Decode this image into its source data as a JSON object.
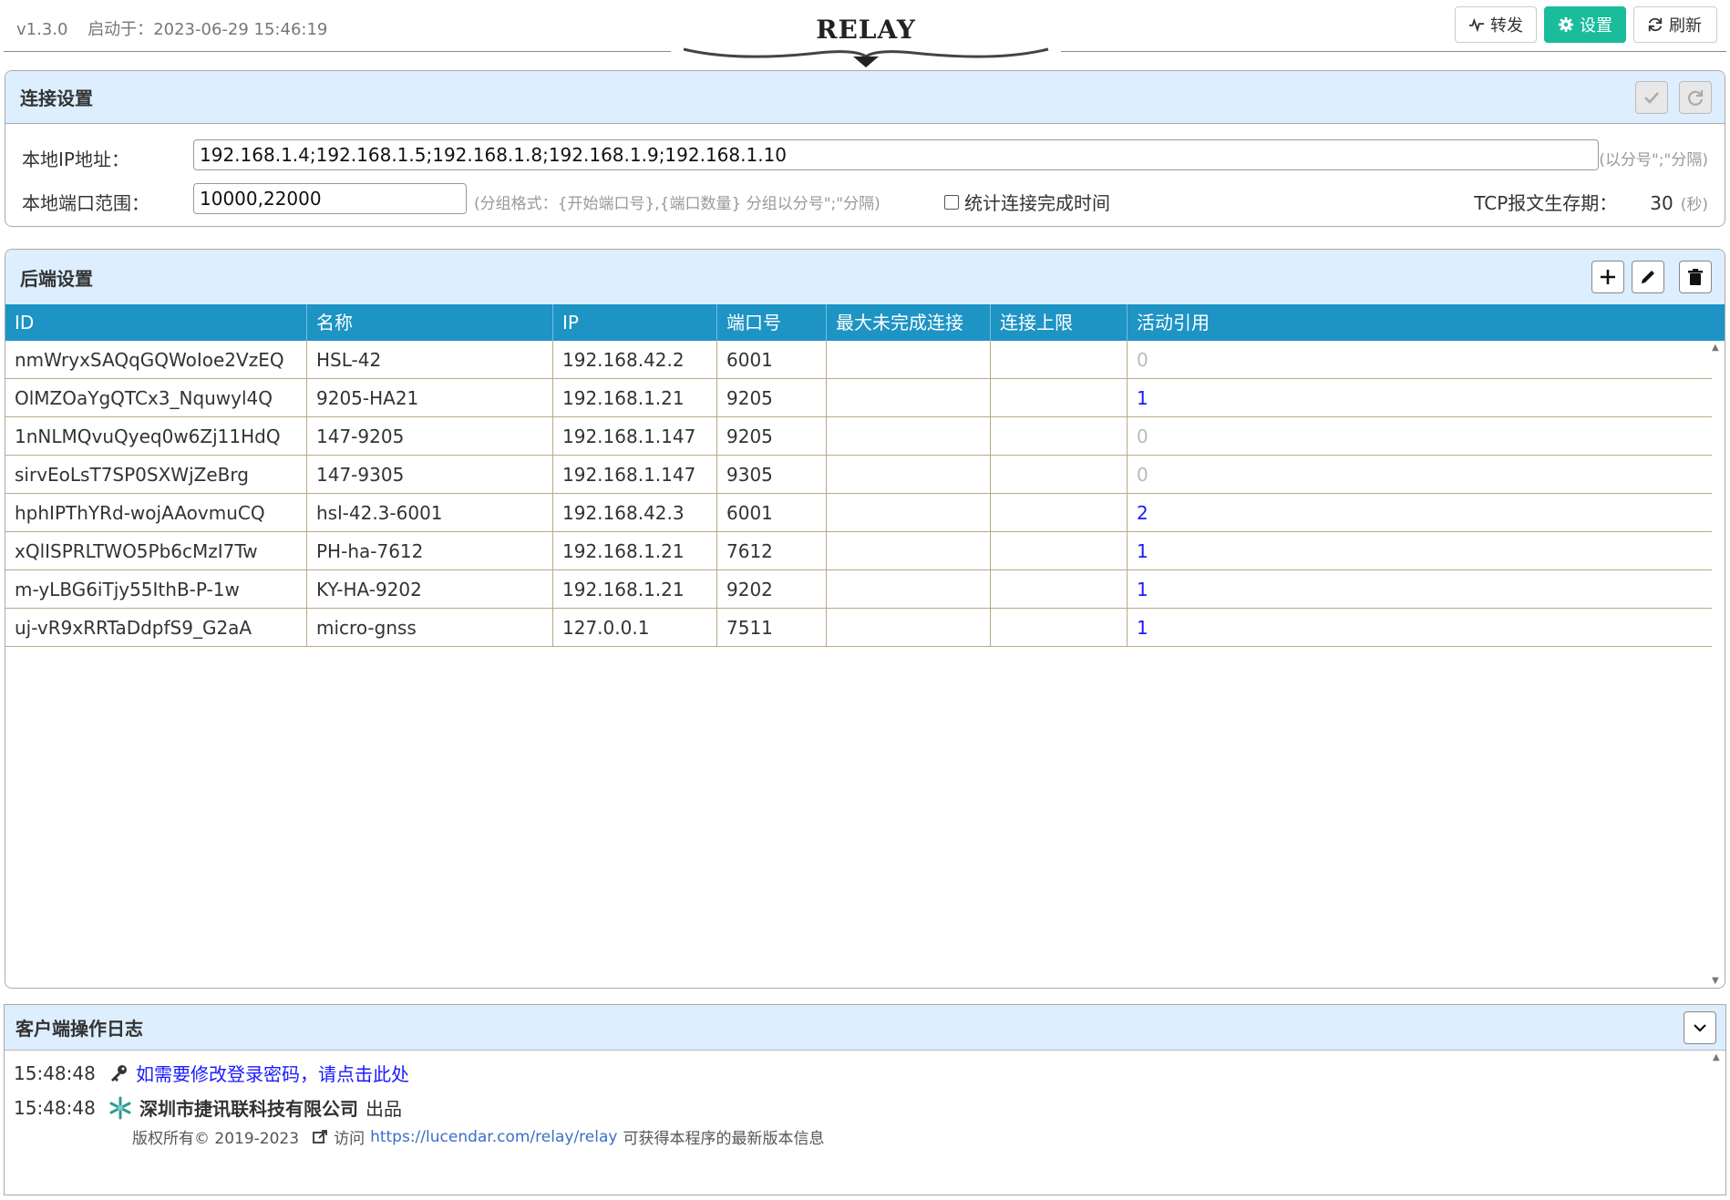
{
  "header": {
    "version": "v1.3.0",
    "start_label": "启动于：",
    "start_time": "2023-06-29 15:46:19",
    "logo": "RELAY",
    "buttons": {
      "forward": "转发",
      "settings": "设置",
      "refresh": "刷新"
    }
  },
  "connection": {
    "title": "连接设置",
    "ip_label": "本地IP地址：",
    "ip_value": "192.168.1.4;192.168.1.5;192.168.1.8;192.168.1.9;192.168.1.10",
    "ip_hint": "(以分号\";\"分隔)",
    "port_label": "本地端口范围：",
    "port_value": "10000,22000",
    "port_hint": "(分组格式：{开始端口号},{端口数量} 分组以分号\";\"分隔)",
    "stat_label": "统计连接完成时间",
    "ttl_label": "TCP报文生存期：",
    "ttl_value": "30",
    "ttl_unit": "(秒)"
  },
  "backend": {
    "title": "后端设置",
    "columns": [
      "ID",
      "名称",
      "IP",
      "端口号",
      "最大未完成连接",
      "连接上限",
      "活动引用"
    ],
    "rows": [
      {
        "id": "nmWryxSAQqGQWoIoe2VzEQ",
        "name": "HSL-42",
        "ip": "192.168.42.2",
        "port": "6001",
        "max_pending": "",
        "limit": "",
        "refs": "0"
      },
      {
        "id": "OlMZOaYgQTCx3_Nquwyl4Q",
        "name": "9205-HA21",
        "ip": "192.168.1.21",
        "port": "9205",
        "max_pending": "",
        "limit": "",
        "refs": "1"
      },
      {
        "id": "1nNLMQvuQyeq0w6Zj11HdQ",
        "name": "147-9205",
        "ip": "192.168.1.147",
        "port": "9205",
        "max_pending": "",
        "limit": "",
        "refs": "0"
      },
      {
        "id": "sirvEoLsT7SP0SXWjZeBrg",
        "name": "147-9305",
        "ip": "192.168.1.147",
        "port": "9305",
        "max_pending": "",
        "limit": "",
        "refs": "0"
      },
      {
        "id": "hphIPThYRd-wojAAovmuCQ",
        "name": "hsl-42.3-6001",
        "ip": "192.168.42.3",
        "port": "6001",
        "max_pending": "",
        "limit": "",
        "refs": "2"
      },
      {
        "id": "xQlISPRLTWO5Pb6cMzI7Tw",
        "name": "PH-ha-7612",
        "ip": "192.168.1.21",
        "port": "7612",
        "max_pending": "",
        "limit": "",
        "refs": "1"
      },
      {
        "id": "m-yLBG6iTjy55IthB-P-1w",
        "name": "KY-HA-9202",
        "ip": "192.168.1.21",
        "port": "9202",
        "max_pending": "",
        "limit": "",
        "refs": "1"
      },
      {
        "id": "uj-vR9xRRTaDdpfS9_G2aA",
        "name": "micro-gnss",
        "ip": "127.0.0.1",
        "port": "7511",
        "max_pending": "",
        "limit": "",
        "refs": "1"
      }
    ]
  },
  "log": {
    "title": "客户端操作日志",
    "entries": [
      {
        "time": "15:48:48",
        "text": "如需要修改登录密码，请点击此处"
      },
      {
        "time": "15:48:48",
        "company": "深圳市捷讯联科技有限公司",
        "suffix": "出品"
      }
    ],
    "copyright": "版权所有© 2019-2023",
    "visit": "访问",
    "url": "https://lucendar.com/relay/relay",
    "url_suffix": "可获得本程序的最新版本信息"
  }
}
